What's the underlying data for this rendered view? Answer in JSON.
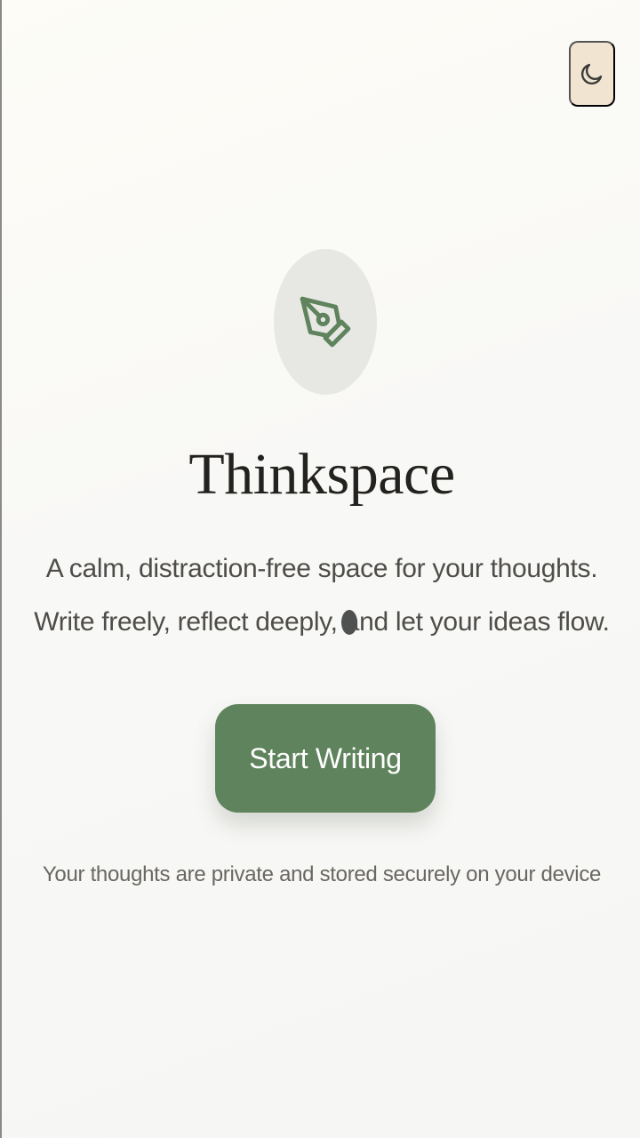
{
  "header": {
    "theme_toggle_icon": "moon-icon"
  },
  "hero": {
    "logo_icon": "pen-nib-icon",
    "title": "Thinkspace",
    "tagline": "A calm, distraction-free space for your thoughts. Write freely, reflect deeply, and let your ideas flow.",
    "start_button_label": "Start Writing",
    "privacy_note": "Your thoughts are private and stored securely on your device"
  },
  "colors": {
    "accent_green": "#5f835c",
    "toggle_background": "#f1e5d2",
    "logo_circle_background": "#e7e8e4"
  }
}
